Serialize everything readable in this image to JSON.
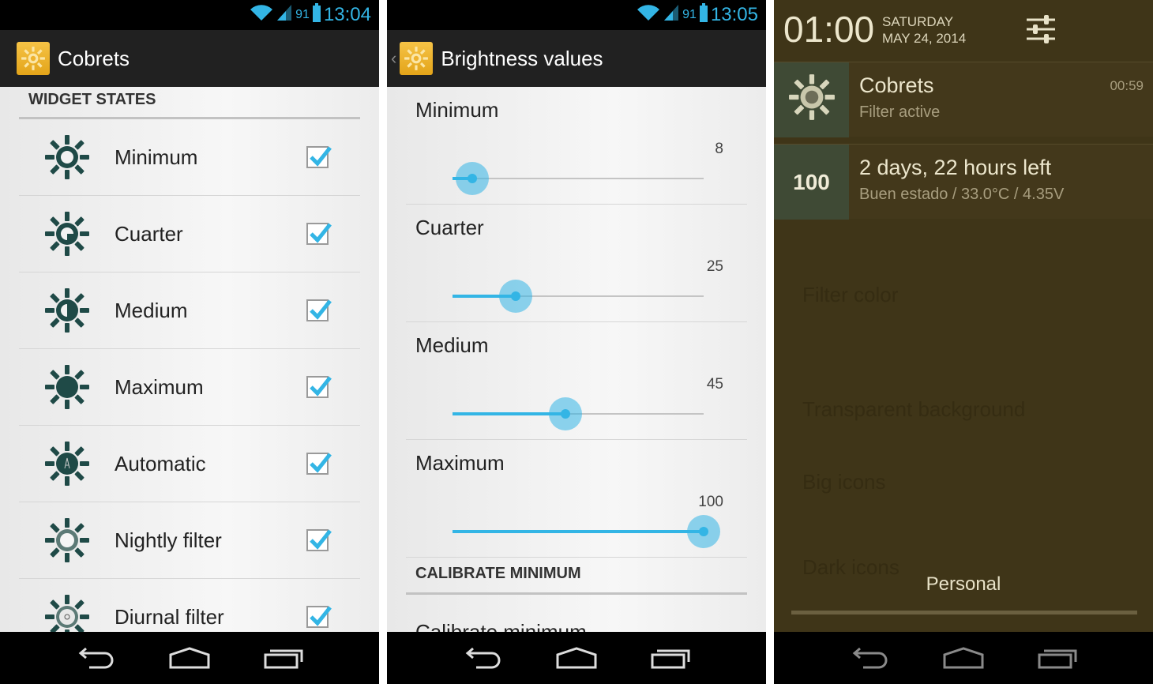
{
  "colors": {
    "accent": "#33b5e5",
    "notif_bg": "#3f3518",
    "icon_tile": "#3f4a35"
  },
  "panel1": {
    "status": {
      "battery": "91",
      "time": "13:04"
    },
    "app_title": "Cobrets",
    "section": "WIDGET STATES",
    "items": [
      {
        "label": "Minimum",
        "icon": "sun-minimum-icon",
        "checked": true
      },
      {
        "label": "Cuarter",
        "icon": "sun-quarter-icon",
        "checked": true
      },
      {
        "label": "Medium",
        "icon": "sun-medium-icon",
        "checked": true
      },
      {
        "label": "Maximum",
        "icon": "sun-maximum-icon",
        "checked": true
      },
      {
        "label": "Automatic",
        "icon": "sun-automatic-icon",
        "checked": true
      },
      {
        "label": "Nightly filter",
        "icon": "sun-nightly-icon",
        "checked": true
      },
      {
        "label": "Diurnal filter",
        "icon": "sun-diurnal-icon",
        "checked": true
      }
    ]
  },
  "panel2": {
    "status": {
      "battery": "91",
      "time": "13:05"
    },
    "title": "Brightness values",
    "sliders": [
      {
        "label": "Minimum",
        "value": 8,
        "value_text": "8"
      },
      {
        "label": "Cuarter",
        "value": 25,
        "value_text": "25"
      },
      {
        "label": "Medium",
        "value": 45,
        "value_text": "45"
      },
      {
        "label": "Maximum",
        "value": 100,
        "value_text": "100"
      }
    ],
    "slider_max": 100,
    "section": "CALIBRATE MINIMUM",
    "partial_item": "Calibrate minimum"
  },
  "panel3": {
    "time": "01:00",
    "day": "SATURDAY",
    "date": "MAY 24, 2014",
    "notifications": [
      {
        "title": "Cobrets",
        "subtitle": "Filter active",
        "time": "00:59"
      },
      {
        "badge": "100",
        "title": "2 days, 22 hours left",
        "subtitle": "Buen estado / 33.0°C / 4.35V"
      }
    ],
    "background_items": [
      "Filter color",
      "Transparent background",
      "Big icons",
      "Dark icons"
    ],
    "user_label": "Personal"
  }
}
